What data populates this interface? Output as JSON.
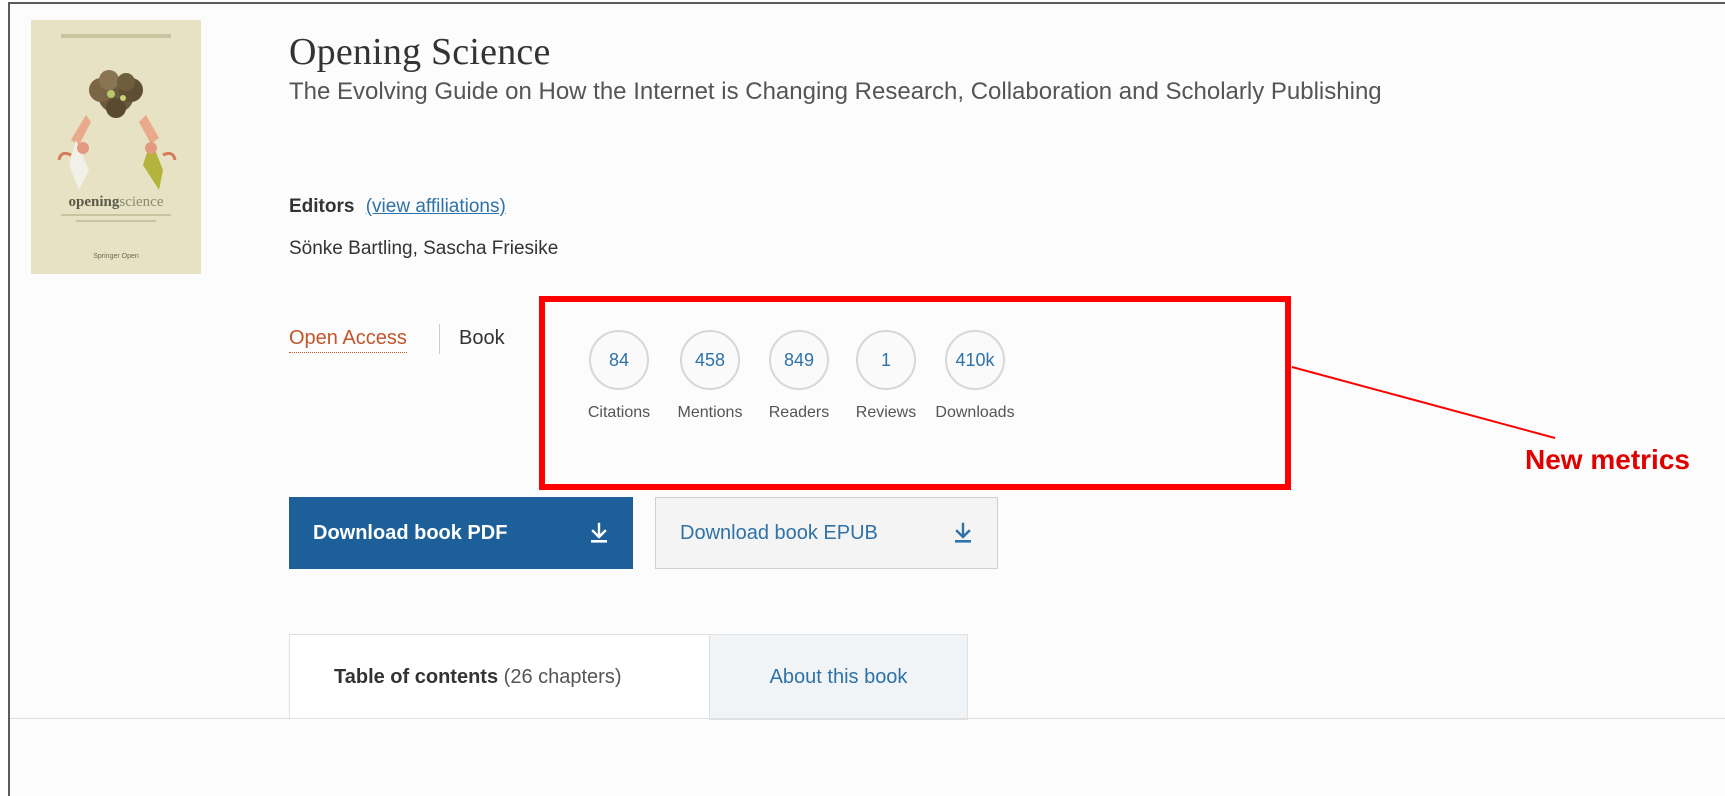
{
  "book": {
    "title": "Opening Science",
    "subtitle": "The Evolving Guide on How the Internet is Changing Research, Collaboration and Scholarly Publishing",
    "cover": {
      "wordmark_bold": "opening",
      "wordmark_light": "science",
      "publisher": "Springer Open"
    }
  },
  "editors": {
    "label": "Editors",
    "affiliations_link": "(view affiliations)",
    "names": "Sönke Bartling, Sascha Friesike"
  },
  "access": {
    "label": "Open Access",
    "content_type": "Book"
  },
  "metrics": [
    {
      "value": "84",
      "label": "Citations"
    },
    {
      "value": "458",
      "label": "Mentions"
    },
    {
      "value": "849",
      "label": "Readers"
    },
    {
      "value": "1",
      "label": "Reviews"
    },
    {
      "value": "410k",
      "label": "Downloads"
    }
  ],
  "annotation": {
    "text": "New metrics",
    "color": "#e00000"
  },
  "downloads": {
    "pdf_label": "Download book PDF",
    "epub_label": "Download book EPUB"
  },
  "tabs": {
    "toc_label": "Table of contents",
    "toc_count": "(26 chapters)",
    "about_label": "About this book"
  },
  "colors": {
    "link_blue": "#2e72a8",
    "primary_button": "#1d5f98",
    "open_access": "#c2552c",
    "highlight": "#ff0000"
  }
}
